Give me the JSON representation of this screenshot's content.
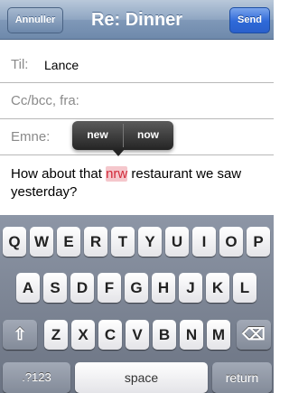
{
  "nav": {
    "title": "Re: Dinner",
    "cancel_label": "Annuller",
    "send_label": "Send"
  },
  "fields": {
    "to_label": "Til:",
    "to_value": "Lance",
    "cc_label": "Cc/bcc, fra:",
    "subject_label": "Emne:"
  },
  "body": {
    "before": "How about that ",
    "highlighted": "nrw",
    "after": " restaurant we saw yesterday?"
  },
  "autocorrect": {
    "options": [
      "new",
      "now"
    ]
  },
  "keyboard": {
    "row1": [
      "Q",
      "W",
      "E",
      "R",
      "T",
      "Y",
      "U",
      "I",
      "O",
      "P"
    ],
    "row2": [
      "A",
      "S",
      "D",
      "F",
      "G",
      "H",
      "J",
      "K",
      "L"
    ],
    "row3": [
      "Z",
      "X",
      "C",
      "V",
      "B",
      "N",
      "M"
    ],
    "shift_icon": "⇧",
    "delete_icon": "⌫",
    "numbers_label": ".?123",
    "space_label": "space",
    "return_label": "return"
  }
}
